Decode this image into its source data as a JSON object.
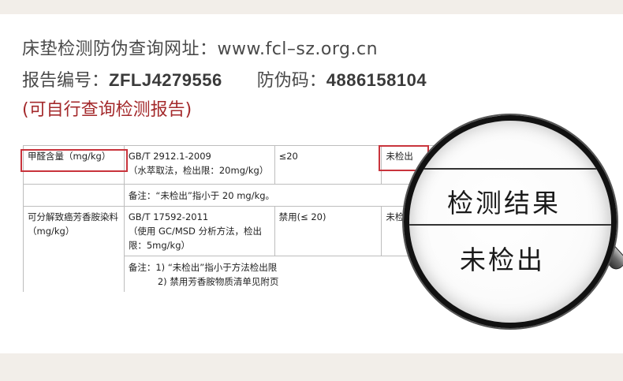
{
  "header": {
    "line1": "床垫检测防伪查询网址：www.fcl–sz.org.cn",
    "report_label": "报告编号：",
    "report_number": "ZFLJ4279556",
    "anti_label": "防伪码：",
    "anti_code": "4886158104",
    "line3": "(可自行查询检测报告)"
  },
  "table": {
    "row1": {
      "item": "甲醛含量（mg/kg）",
      "method_line1": "GB/T 2912.1-2009",
      "method_line2": "（水萃取法，检出限：20mg/kg）",
      "requirement": "≤20",
      "result": "未检出",
      "note": "备注：“未检出”指小于 20 mg/kg。"
    },
    "row2": {
      "item": "可分解致癌芳香胺染料（mg/kg）",
      "method_line1": "GB/T 17592-2011",
      "method_line2": "（使用 GC/MSD 分析方法，检出限：5mg/kg）",
      "requirement": "禁用(≤ 20)",
      "result": "未检",
      "note_line1": "备注：1) “未检出”指小于方法检出限",
      "note_line2": "2)  禁用芳香胺物质清单见附页"
    }
  },
  "magnifier": {
    "label": "检测结果",
    "value": "未检出"
  },
  "colors": {
    "highlight_red": "#c9343c",
    "subtitle_red": "#a42a2c",
    "text_gray": "#4a4a4a"
  }
}
